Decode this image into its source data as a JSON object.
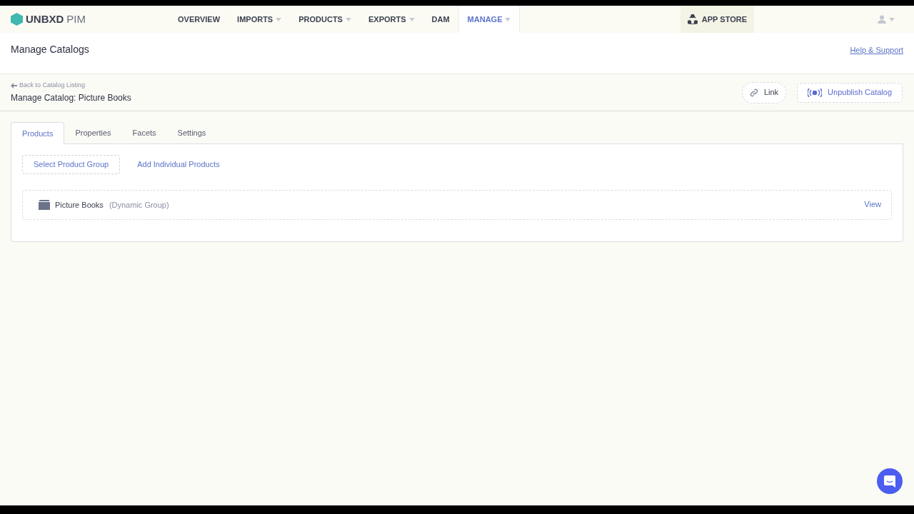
{
  "brand": {
    "name": "UNBXD",
    "product": "PIM"
  },
  "nav": [
    {
      "label": "OVERVIEW",
      "dropdown": false,
      "selected": false
    },
    {
      "label": "IMPORTS",
      "dropdown": true,
      "selected": false
    },
    {
      "label": "PRODUCTS",
      "dropdown": true,
      "selected": false
    },
    {
      "label": "EXPORTS",
      "dropdown": true,
      "selected": false
    },
    {
      "label": "DAM",
      "dropdown": false,
      "selected": false
    },
    {
      "label": "MANAGE",
      "dropdown": true,
      "selected": true
    }
  ],
  "app_store": "APP STORE",
  "page_title": "Manage Catalogs",
  "help_link": "Help & Support",
  "back_link": "Back to Catalog Listing",
  "catalog_title": "Manage Catalog: Picture Books",
  "actions": [
    {
      "label": "Link",
      "kind": "link"
    },
    {
      "label": "Unpublish Catalog",
      "kind": "unpublish"
    }
  ],
  "tabs": [
    {
      "label": "Products",
      "selected": true
    },
    {
      "label": "Properties",
      "selected": false
    },
    {
      "label": "Facets",
      "selected": false
    },
    {
      "label": "Settings",
      "selected": false
    }
  ],
  "sub_tabs": [
    {
      "label": "Select Product Group",
      "selected": true
    },
    {
      "label": "Add Individual Products",
      "selected": false
    }
  ],
  "groups": [
    {
      "name": "Picture Books",
      "type": "(Dynamic Group)",
      "action": "View"
    }
  ]
}
